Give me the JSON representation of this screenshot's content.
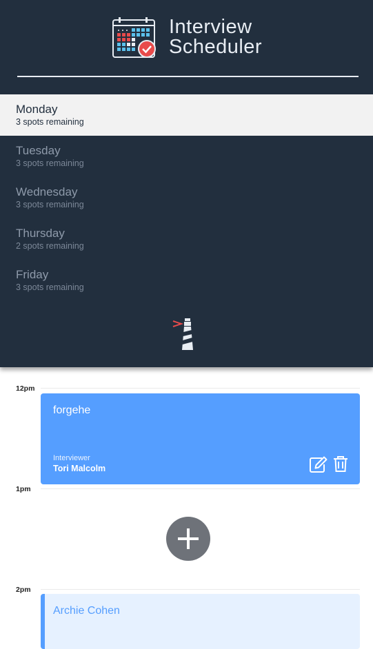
{
  "app": {
    "title_line1": "Interview",
    "title_line2": "Scheduler",
    "brand_icon": "calendar-check-icon",
    "footer_logo": "lighthouse-icon"
  },
  "sidebar": {
    "days": [
      {
        "name": "Monday",
        "spots": "3 spots remaining",
        "selected": true
      },
      {
        "name": "Tuesday",
        "spots": "3 spots remaining",
        "selected": false
      },
      {
        "name": "Wednesday",
        "spots": "3 spots remaining",
        "selected": false
      },
      {
        "name": "Thursday",
        "spots": "2 spots remaining",
        "selected": false
      },
      {
        "name": "Friday",
        "spots": "3 spots remaining",
        "selected": false
      }
    ]
  },
  "schedule": {
    "times": [
      "12pm",
      "1pm",
      "2pm"
    ],
    "appointment": {
      "student": "forgehe",
      "interviewer_label": "Interviewer",
      "interviewer": "Tori Malcolm",
      "edit_icon": "edit-icon",
      "delete_icon": "trash-icon"
    },
    "add_icon": "plus-icon",
    "next_appointment": {
      "student": "Archie Cohen"
    }
  },
  "colors": {
    "sidebar_bg": "#222f3e",
    "selected_bg": "#f2f2f2",
    "appointment_bg": "#559eff",
    "pending_bg": "#e6f1ff",
    "add_button_bg": "#6e7279"
  }
}
